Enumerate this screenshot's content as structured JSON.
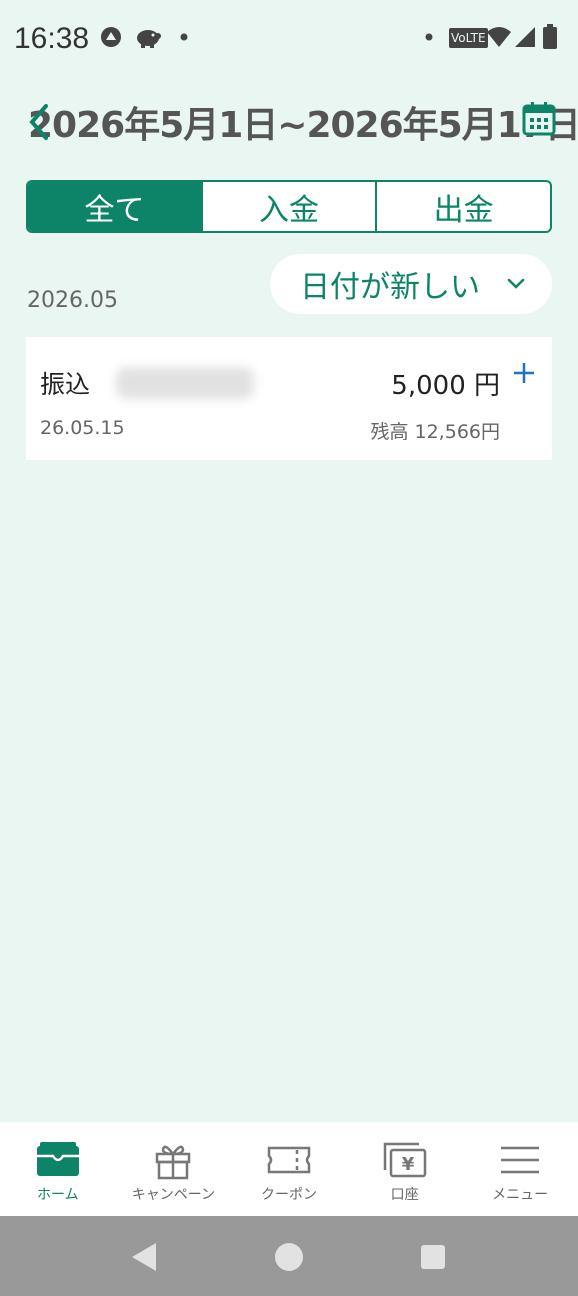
{
  "status_bar": {
    "time": "16:38",
    "network_badge": "VoLTE"
  },
  "header": {
    "date_range": "2026年5月1日~2026年5月17日"
  },
  "filter_tabs": [
    {
      "label": "全て",
      "active": true
    },
    {
      "label": "入金",
      "active": false
    },
    {
      "label": "出金",
      "active": false
    }
  ],
  "month_label": "2026.05",
  "sort": {
    "label": "日付が新しい"
  },
  "transactions": [
    {
      "title": "振込",
      "amount": "5,000 円",
      "date": "26.05.15",
      "balance": "残高 12,566円"
    }
  ],
  "bottom_nav": [
    {
      "label": "ホーム",
      "icon": "wallet-icon",
      "active": true
    },
    {
      "label": "キャンペーン",
      "icon": "gift-icon",
      "active": false
    },
    {
      "label": "クーポン",
      "icon": "ticket-icon",
      "active": false
    },
    {
      "label": "口座",
      "icon": "yen-account-icon",
      "active": false
    },
    {
      "label": "メニュー",
      "icon": "hamburger-icon",
      "active": false
    }
  ],
  "colors": {
    "accent": "#0d8468",
    "background": "#e9f6f1",
    "plus_blue": "#1e73be"
  }
}
